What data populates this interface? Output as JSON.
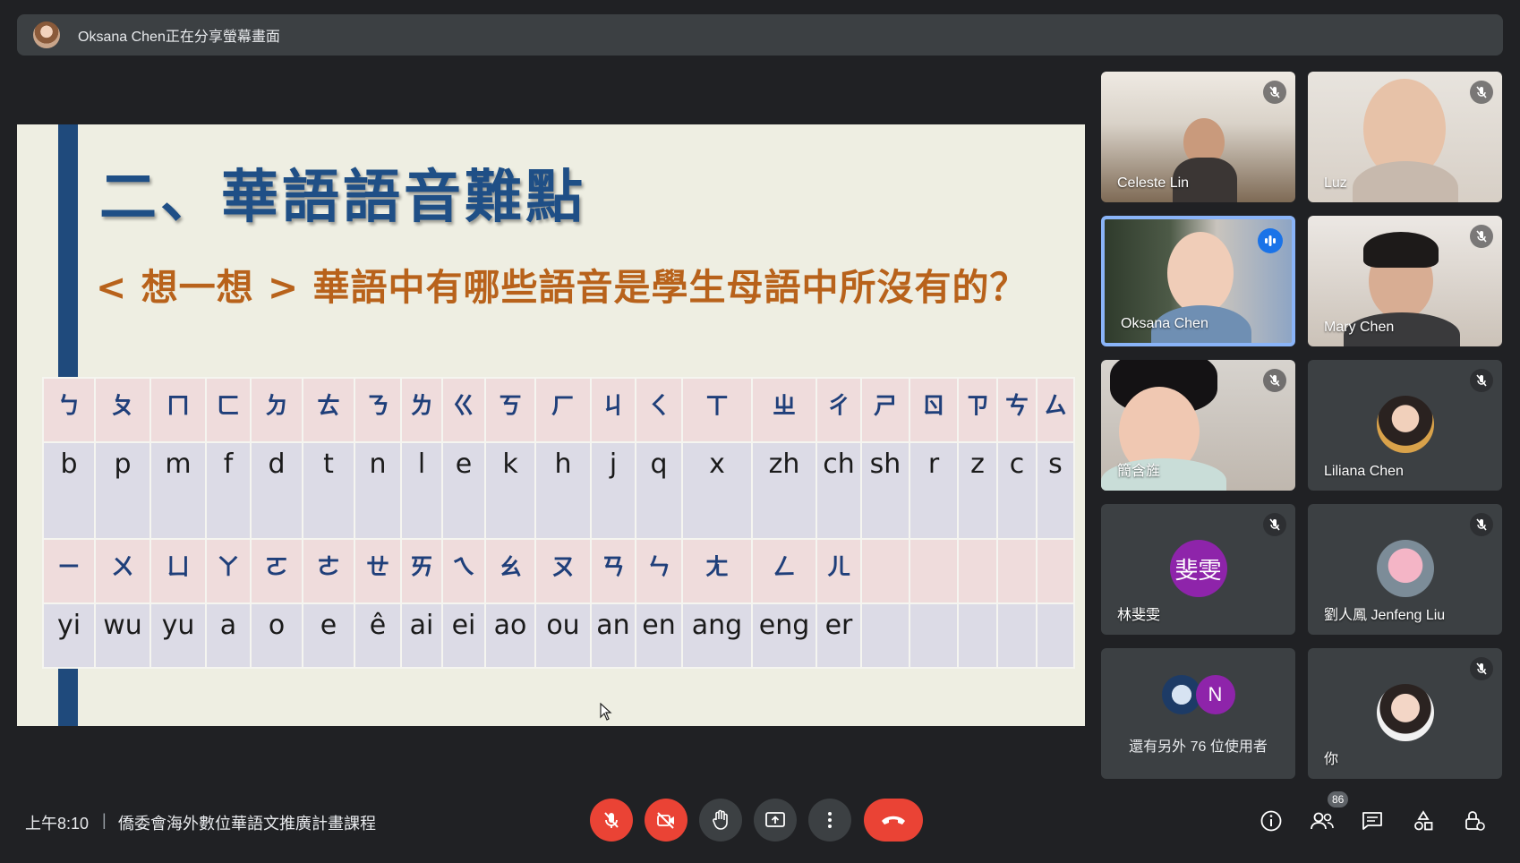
{
  "share_banner": {
    "text": "Oksana Chen正在分享螢幕畫面"
  },
  "slide": {
    "title": "二、華語語音難點",
    "subtitle": "< 想一想 > 華語中有哪些語音是學生母語中所沒有的？",
    "table": {
      "symbols_row1": [
        "ㄅ",
        "ㄆ",
        "ㄇ",
        "ㄈ",
        "ㄉ",
        "ㄊ",
        "ㄋ",
        "ㄌ",
        "ㄍ",
        "ㄎ",
        "ㄏ",
        "ㄐ",
        "ㄑ",
        "ㄒ",
        "ㄓ",
        "ㄔ",
        "ㄕ",
        "ㄖ",
        "ㄗ",
        "ㄘ",
        "ㄙ"
      ],
      "latin_row1": [
        "b",
        "p",
        "m",
        "f",
        "d",
        "t",
        "n",
        "l",
        "e",
        "k",
        "h",
        "j",
        "q",
        "x",
        "zh",
        "ch",
        "sh",
        "r",
        "z",
        "c",
        "s"
      ],
      "symbols_row2": [
        "ㄧ",
        "ㄨ",
        "ㄩ",
        "ㄚ",
        "ㄛ",
        "ㄜ",
        "ㄝ",
        "ㄞ",
        "ㄟ",
        "ㄠ",
        "ㄡ",
        "ㄢ",
        "ㄣ",
        "ㄤ",
        "ㄥ",
        "ㄦ",
        "",
        "",
        "",
        "",
        ""
      ],
      "latin_row2": [
        "yi",
        "wu",
        "yu",
        "a",
        "o",
        "e",
        "ê",
        "ai",
        "ei",
        "ao",
        "ou",
        "an",
        "en",
        "ang",
        "eng",
        "er",
        "",
        "",
        "",
        "",
        ""
      ]
    }
  },
  "participants": [
    {
      "name": "Celeste Lin",
      "muted": true,
      "type": "video"
    },
    {
      "name": "Luz",
      "muted": true,
      "type": "video"
    },
    {
      "name": "Oksana Chen",
      "muted": false,
      "speaking": true,
      "type": "video"
    },
    {
      "name": "Mary Chen",
      "muted": true,
      "type": "video"
    },
    {
      "name": "簡含旌",
      "muted": true,
      "type": "video"
    },
    {
      "name": "Liliana Chen",
      "muted": true,
      "type": "photo"
    },
    {
      "name": "林斐雯",
      "muted": true,
      "type": "initials",
      "initials": "斐雯",
      "color": "#8e24aa"
    },
    {
      "name": "劉人鳳 Jenfeng Liu",
      "muted": true,
      "type": "photo"
    },
    {
      "name": "你",
      "muted": true,
      "type": "photo"
    }
  ],
  "others": {
    "text": "還有另外 76 位使用者",
    "avatar_letter": "N",
    "avatar_color": "#8e24aa"
  },
  "bottom_bar": {
    "time": "上午8:10",
    "separator": "|",
    "meeting_title": "僑委會海外數位華語文推廣計畫課程",
    "people_count": "86",
    "controls": [
      "mic-off-icon",
      "camera-off-icon",
      "raise-hand-icon",
      "present-screen-icon",
      "more-options-icon",
      "end-call-icon"
    ],
    "side_icons": [
      "info-icon",
      "people-icon",
      "chat-icon",
      "activities-icon",
      "host-controls-icon"
    ]
  },
  "colors": {
    "accent": "#8ab4f8",
    "danger": "#ea4335",
    "title_blue": "#1f4f86",
    "subtitle_orange": "#b8621b"
  }
}
